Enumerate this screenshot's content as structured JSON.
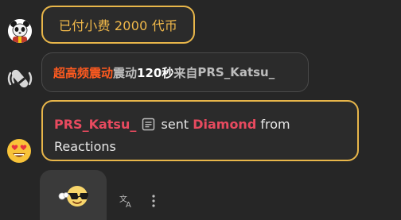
{
  "messages": [
    {
      "type": "tip",
      "avatar_icon": "panda-avatar-icon",
      "text": "已付小费 2000 代币",
      "accent": "#e8b64a"
    },
    {
      "type": "vibration",
      "icon": "vibrate-icon",
      "intensity": "超高频震动",
      "action": "震动",
      "duration": "120秒",
      "from_label": "来自",
      "user": "PRS_Katsu_",
      "intensity_color": "#ff5a1f"
    },
    {
      "type": "reaction_gift",
      "icon": "heart-eyes-emoji-icon",
      "user": "PRS_Katsu_",
      "doc_icon": "document-icon",
      "sent_label": "sent",
      "gift": "Diamond",
      "from_label": "from",
      "source": "Reactions",
      "accent": "#e8b64a",
      "name_color": "#e84a5f"
    },
    {
      "type": "sticker",
      "sticker": "sunglasses-emoji-sticker",
      "actions": [
        "translate-icon",
        "more-options-icon"
      ]
    }
  ]
}
